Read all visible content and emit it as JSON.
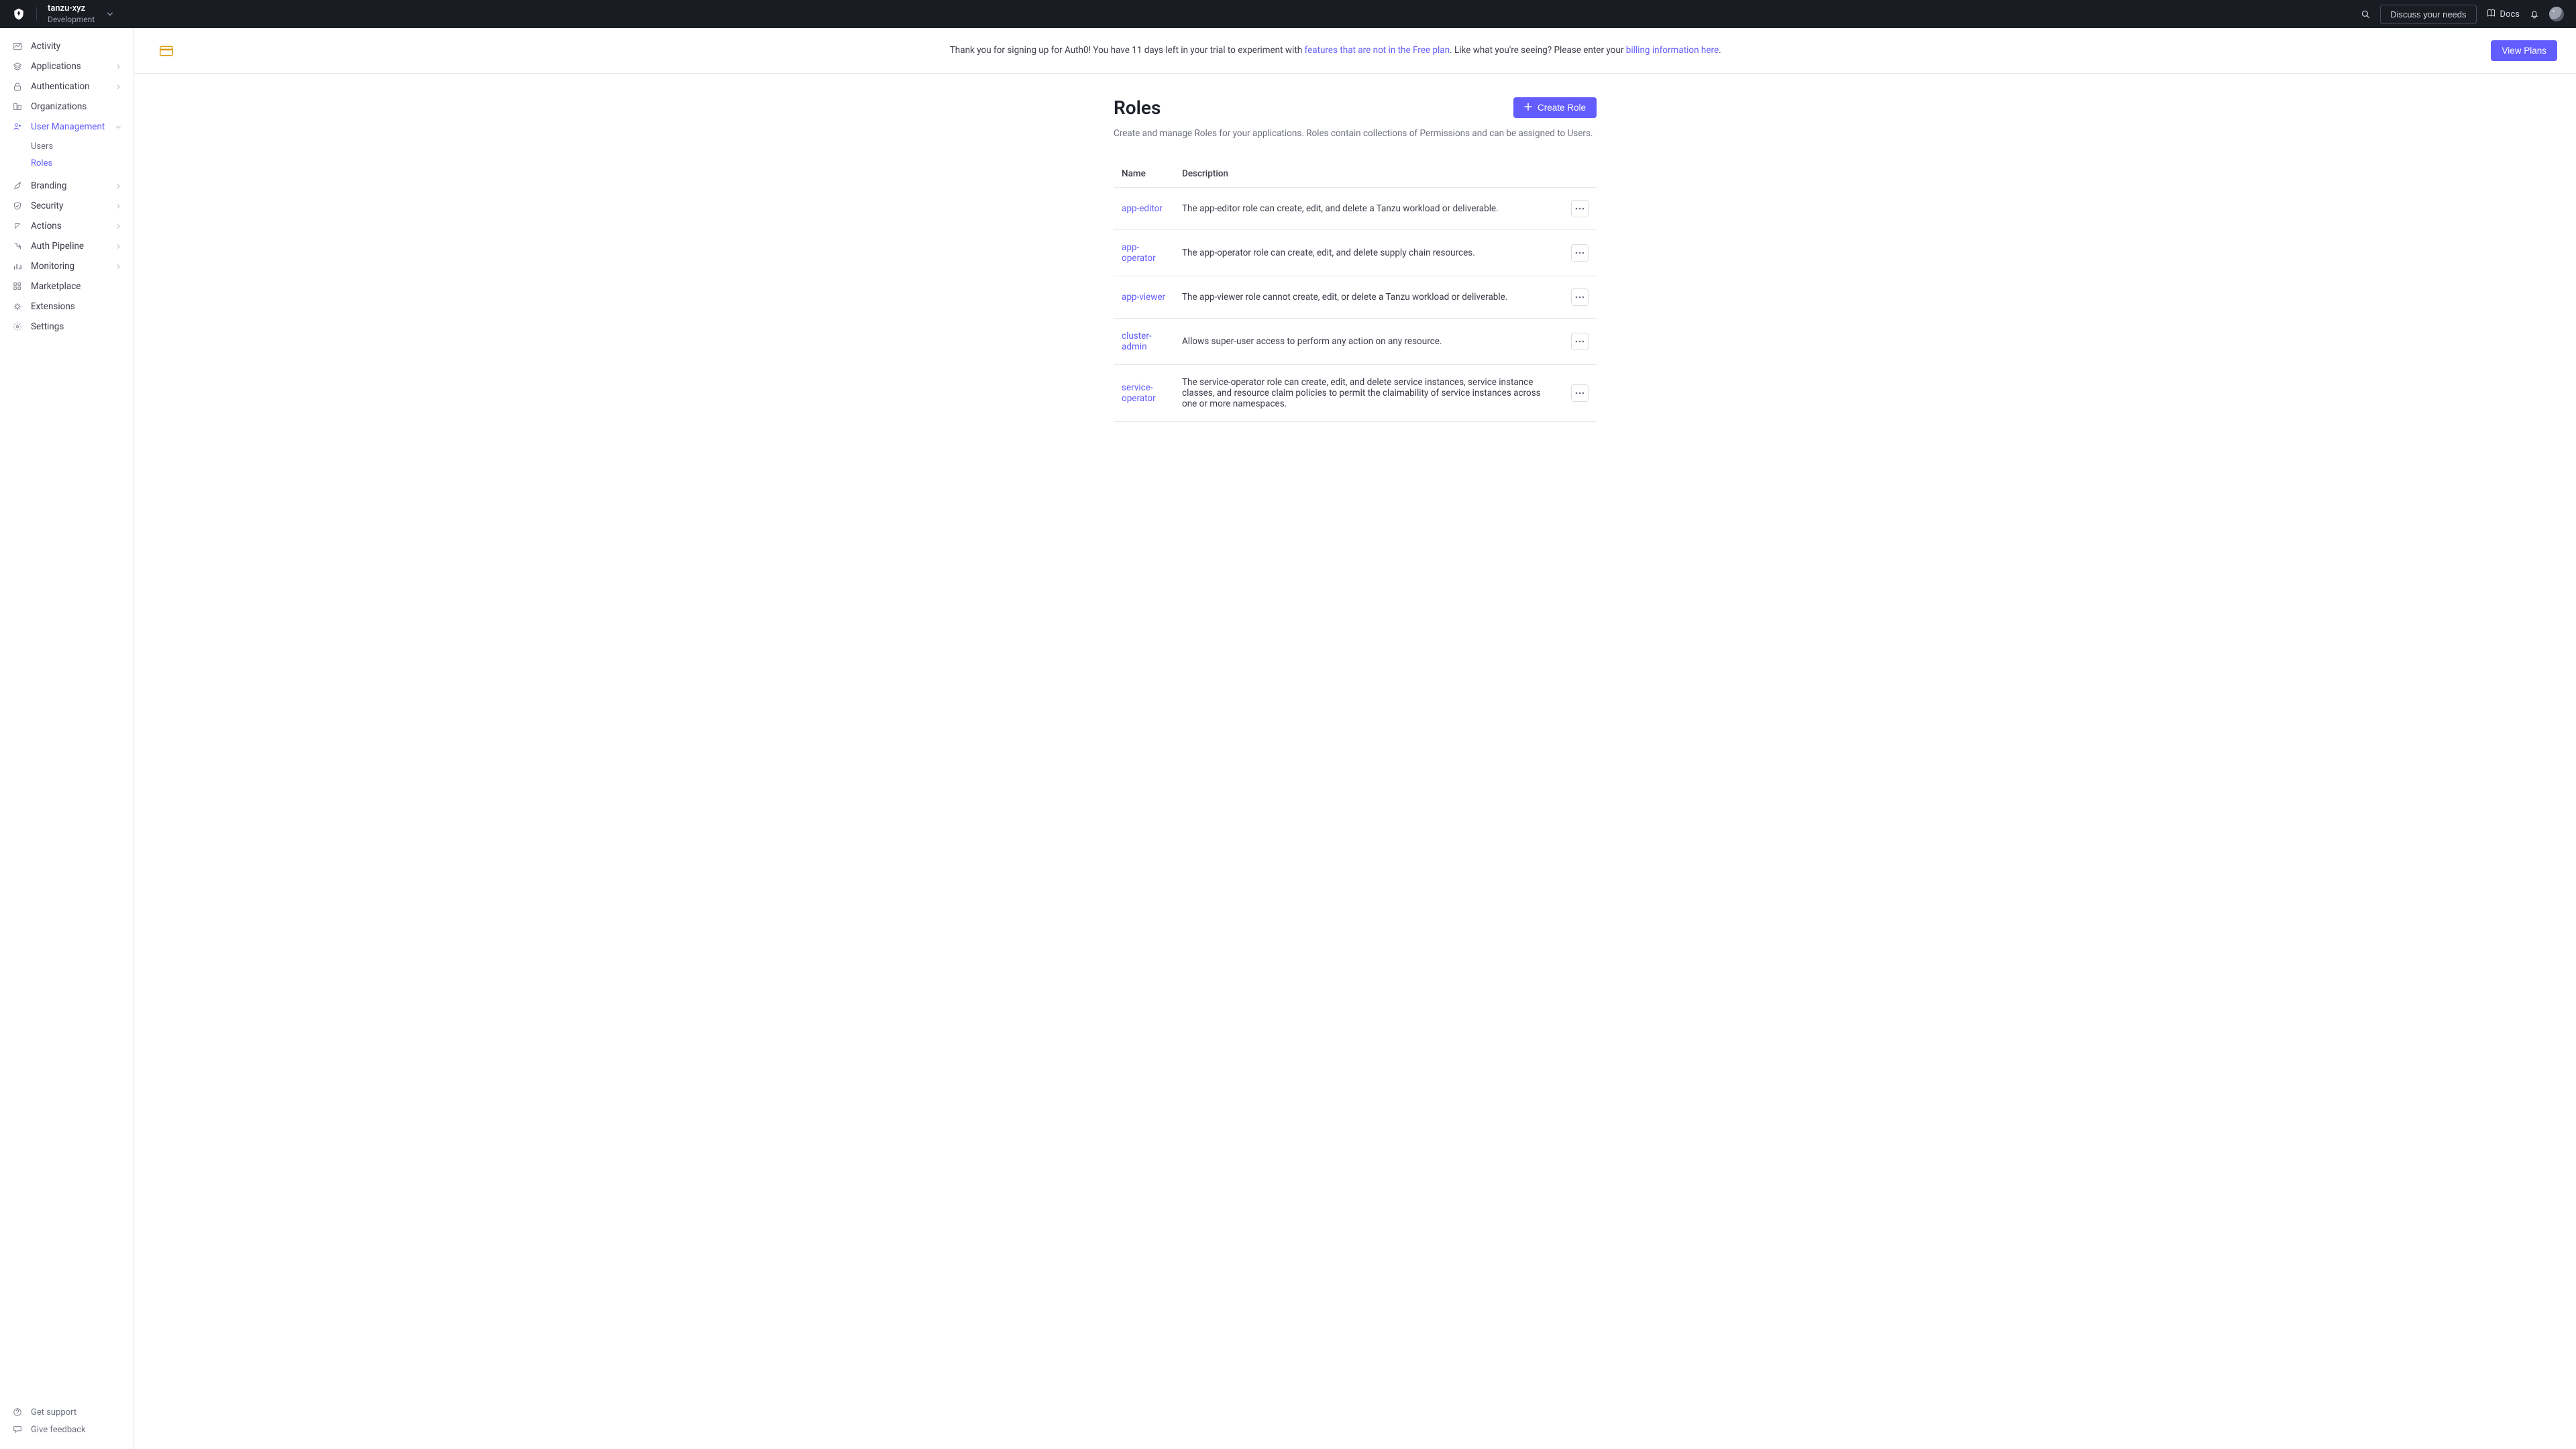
{
  "colors": {
    "accent": "#635dff",
    "topbar_bg": "#1a1c24",
    "text": "#1e212a",
    "muted": "#6b6f7c",
    "border": "#e6e7ec"
  },
  "topbar": {
    "tenant_name": "tanzu-xyz",
    "tenant_env": "Development",
    "discuss_label": "Discuss your needs",
    "docs_label": "Docs"
  },
  "sidebar": {
    "items": [
      {
        "label": "Activity"
      },
      {
        "label": "Applications",
        "expandable": true
      },
      {
        "label": "Authentication",
        "expandable": true
      },
      {
        "label": "Organizations"
      },
      {
        "label": "User Management",
        "expandable": true,
        "active": true,
        "sub": [
          {
            "label": "Users"
          },
          {
            "label": "Roles",
            "active": true
          }
        ]
      },
      {
        "label": "Branding",
        "expandable": true
      },
      {
        "label": "Security",
        "expandable": true
      },
      {
        "label": "Actions",
        "expandable": true
      },
      {
        "label": "Auth Pipeline",
        "expandable": true
      },
      {
        "label": "Monitoring",
        "expandable": true
      },
      {
        "label": "Marketplace"
      },
      {
        "label": "Extensions"
      },
      {
        "label": "Settings"
      }
    ],
    "support_label": "Get support",
    "feedback_label": "Give feedback"
  },
  "banner": {
    "text_a": "Thank you for signing up for Auth0! You have 11 days left in your trial to experiment with ",
    "link_a": "features that are not in the Free plan",
    "text_b": ". Like what you're seeing? Please enter your ",
    "link_b": "billing information here",
    "text_c": ".",
    "plans_label": "View Plans"
  },
  "page": {
    "title": "Roles",
    "create_label": "Create Role",
    "description": "Create and manage Roles for your applications. Roles contain collections of Permissions and can be assigned to Users."
  },
  "table": {
    "col_name": "Name",
    "col_desc": "Description",
    "rows": [
      {
        "name": "app-editor",
        "desc": "The app-editor role can create, edit, and delete a Tanzu workload or deliverable."
      },
      {
        "name": "app-operator",
        "desc": "The app-operator role can create, edit, and delete supply chain resources."
      },
      {
        "name": "app-viewer",
        "desc": "The app-viewer role cannot create, edit, or delete a Tanzu workload or deliverable."
      },
      {
        "name": "cluster-admin",
        "desc": "Allows super-user access to perform any action on any resource."
      },
      {
        "name": "service-operator",
        "desc": "The service-operator role can create, edit, and delete service instances, service instance classes, and resource claim policies to permit the claimability of service instances across one or more namespaces."
      }
    ]
  }
}
